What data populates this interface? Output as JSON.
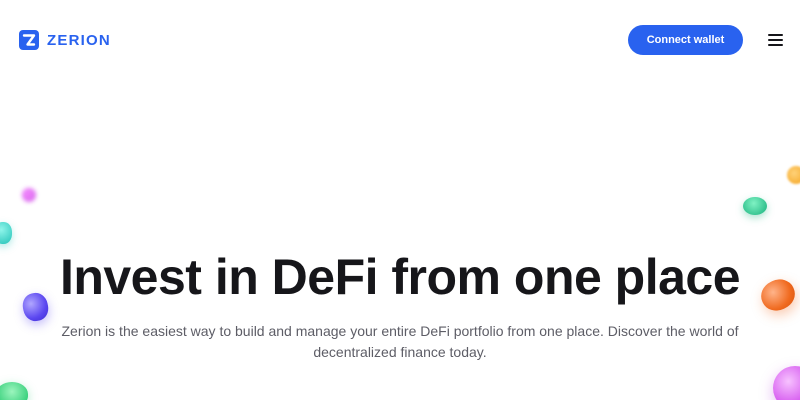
{
  "header": {
    "logo_text": "ZERION",
    "connect_label": "Connect wallet",
    "menu_icon": "hamburger-menu-icon"
  },
  "hero": {
    "title": "Invest in DeFi from one place",
    "subtitle": "Zerion is the easiest way to build and manage your entire DeFi portfolio from one place. Discover the world of decentralized finance today."
  },
  "colors": {
    "brand": "#2962ef",
    "text": "#16161a",
    "muted": "#5d5d66",
    "background": "#ffffff"
  },
  "decor": [
    "magenta-blob",
    "teal-blob",
    "purple-blob",
    "green-blob",
    "orange-blob",
    "pink-blob"
  ]
}
